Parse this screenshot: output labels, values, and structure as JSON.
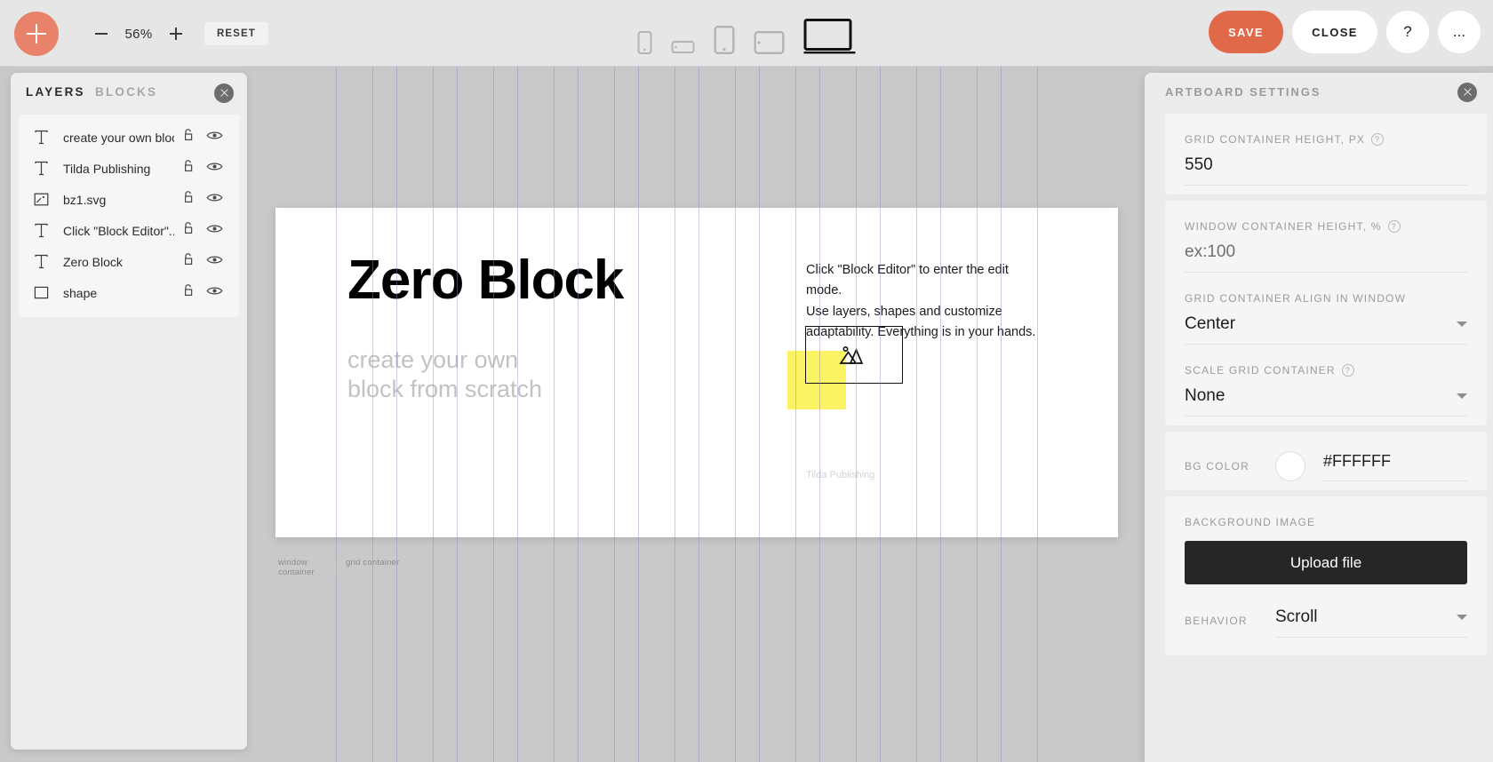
{
  "toolbar": {
    "add_label": "+",
    "zoom_out_label": "−",
    "zoom_value": "56%",
    "zoom_in_label": "+",
    "reset_label": "RESET",
    "devices": [
      {
        "name": "phone-portrait",
        "selected": false
      },
      {
        "name": "phone-landscape",
        "selected": false
      },
      {
        "name": "tablet-portrait",
        "selected": false
      },
      {
        "name": "tablet-landscape",
        "selected": false
      },
      {
        "name": "desktop",
        "selected": true
      }
    ],
    "save_label": "SAVE",
    "close_label": "CLOSE",
    "help_label": "?",
    "more_label": "..."
  },
  "left_panel": {
    "tab_layers": "LAYERS",
    "tab_blocks": "BLOCKS",
    "close_label": "×",
    "layers": [
      {
        "name": "create your own bloc...",
        "icon": "text-layer-icon"
      },
      {
        "name": "Tilda Publishing",
        "icon": "text-layer-icon"
      },
      {
        "name": "bz1.svg",
        "icon": "image-layer-icon"
      },
      {
        "name": "Click \"Block Editor\"...",
        "icon": "text-layer-icon"
      },
      {
        "name": "Zero Block",
        "icon": "text-layer-icon"
      },
      {
        "name": "shape",
        "icon": "shape-layer-icon"
      }
    ],
    "lock_icon": "unlock-icon",
    "eye_icon": "eye-icon"
  },
  "right_panel": {
    "title": "ARTBOARD SETTINGS",
    "close_label": "×",
    "grid_height": {
      "label": "GRID CONTAINER HEIGHT, PX",
      "value": "550",
      "help": "?"
    },
    "window_height": {
      "label": "WINDOW CONTAINER HEIGHT, %",
      "value": "ex:100",
      "help": "?",
      "is_placeholder": true
    },
    "grid_align": {
      "label": "GRID CONTAINER ALIGN IN WINDOW",
      "value": "Center"
    },
    "scale_grid": {
      "label": "SCALE GRID CONTAINER",
      "value": "None",
      "help": "?"
    },
    "bg_color": {
      "label": "BG COLOR",
      "value": "#FFFFFF",
      "swatch": "#FFFFFF"
    },
    "background_image": {
      "label": "BACKGROUND IMAGE",
      "upload_label": "Upload file"
    },
    "behavior": {
      "label": "BEHAVIOR",
      "value": "Scroll"
    }
  },
  "canvas": {
    "window_container_label": "window container",
    "grid_container_label": "grid container",
    "artboard": {
      "heading": "Zero Block",
      "subheading_line1": "create your own",
      "subheading_line2": "block from scratch",
      "description_line1": "Click \"Block Editor\" to enter the edit mode.",
      "description_line2": "Use layers, shapes and customize",
      "description_line3": "adaptability. Everything is in your hands.",
      "footer": "Tilda Publishing",
      "shape_color": "#FBF264",
      "image_placeholder": "image-placeholder-icon"
    }
  },
  "colors": {
    "accent": "#E0694A",
    "add_button": "#E8826A",
    "canvas_bg": "#C9C9C9",
    "panel_bg": "#EDEDED",
    "toolbar_bg": "#E6E6E6",
    "grid_line": "#8E8EC8"
  }
}
